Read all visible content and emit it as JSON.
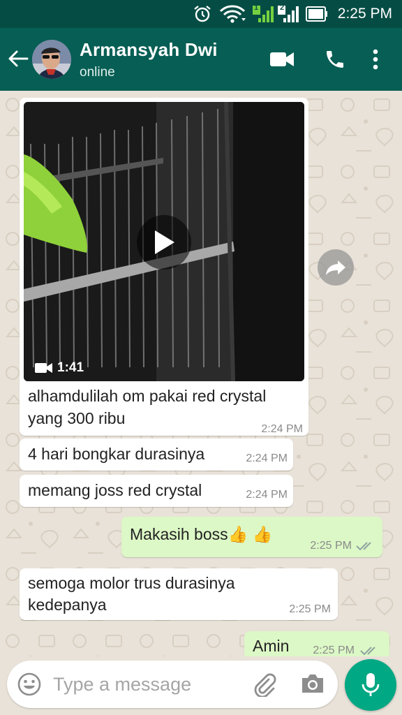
{
  "status_bar": {
    "time": "2:25 PM",
    "icons": [
      "alarm-icon",
      "wifi-icon",
      "sim1-signal-icon",
      "sim2-signal-icon",
      "battery-icon"
    ],
    "sim1_label": "1",
    "sim2_label": "2"
  },
  "header": {
    "contact_name": "Armansyah Dwi",
    "contact_status": "online",
    "icons": [
      "back-arrow-icon",
      "video-call-icon",
      "phone-icon",
      "more-vert-icon"
    ]
  },
  "messages": [
    {
      "direction": "incoming",
      "type": "video",
      "video_duration": "1:41",
      "text_line1": "alhamdulilah om pakai red crystal",
      "text_line2": "yang 300 ribu",
      "time": "2:24 PM"
    },
    {
      "direction": "incoming",
      "type": "text",
      "text": "4 hari bongkar durasinya",
      "time": "2:24 PM"
    },
    {
      "direction": "incoming",
      "type": "text",
      "text": "memang joss red crystal",
      "time": "2:24 PM"
    },
    {
      "direction": "outgoing",
      "type": "text",
      "text": "Makasih boss👍 👍",
      "time": "2:25 PM",
      "status": "read"
    },
    {
      "direction": "incoming",
      "type": "text",
      "text_line1": "semoga molor trus durasinya",
      "text_line2": "kedepanya",
      "time": "2:25 PM"
    },
    {
      "direction": "outgoing",
      "type": "text",
      "text": "Amin",
      "time": "2:25 PM",
      "status": "read"
    }
  ],
  "composer": {
    "placeholder": "Type a message",
    "icons": [
      "emoji-icon",
      "attach-icon",
      "camera-icon",
      "mic-icon"
    ]
  },
  "colors": {
    "header": "#075e54",
    "status_bar": "#054d44",
    "chat_background": "#e9e2d8",
    "outgoing_bubble": "#dcf8c6",
    "incoming_bubble": "#ffffff",
    "accent": "#00a884",
    "read_ticks": "#8fa3a1"
  }
}
